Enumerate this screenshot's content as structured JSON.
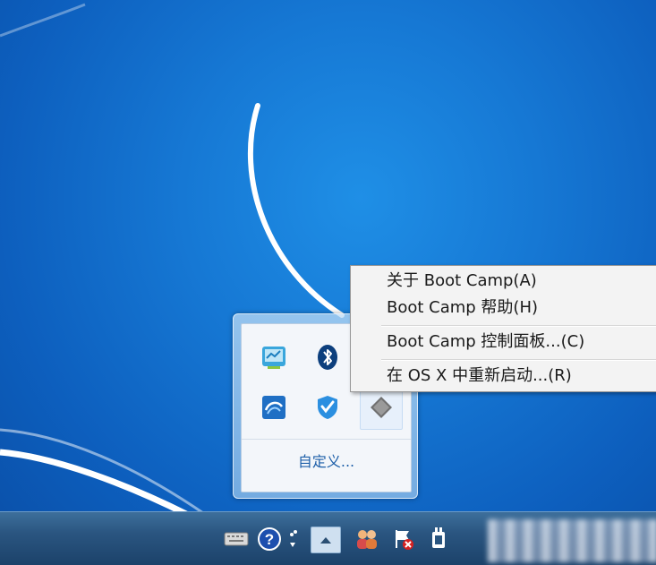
{
  "tray_panel": {
    "customize_label": "自定义...",
    "icons": [
      "monitor-app-icon",
      "bluetooth-icon",
      "",
      "network-shield-icon",
      "security-shield-icon",
      "bootcamp-diamond-icon"
    ]
  },
  "context_menu": {
    "items": [
      {
        "label": "关于 Boot Camp(A)"
      },
      {
        "label": "Boot Camp 帮助(H)"
      },
      {
        "label": "Boot Camp 控制面板...(C)"
      },
      {
        "label": "在 OS X 中重新启动...(R)"
      }
    ]
  },
  "taskbar": {
    "icons": [
      "keyboard-icon",
      "help-icon",
      "network-dots-icon",
      "show-hidden-icons-button",
      "users-icon",
      "action-center-flag-icon",
      "power-plug-icon"
    ]
  },
  "colors": {
    "desktop": "#1678d4",
    "menu_bg": "#f3f3f3",
    "taskbar": "#2a5580",
    "link_text": "#1c5ea8"
  }
}
